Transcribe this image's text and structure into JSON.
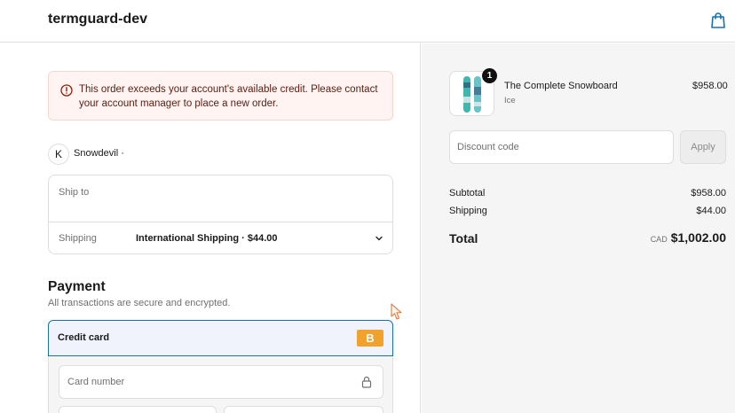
{
  "header": {
    "store_name": "termguard-dev",
    "cart_icon": "shopping-bag-icon"
  },
  "alert": {
    "icon": "warning-circle-icon",
    "message": "This order exceeds your account's available credit. Please contact your account manager to place a new order."
  },
  "account": {
    "avatar_initial": "K",
    "name": "Snowdevil ·"
  },
  "shipping": {
    "ship_to_label": "Ship to",
    "method_label": "Shipping",
    "method_value": "International Shipping · $44.00"
  },
  "payment": {
    "title": "Payment",
    "subtitle": "All transactions are secure and encrypted.",
    "method_label": "Credit card",
    "badge_text": "B",
    "card_number_placeholder": "Card number"
  },
  "summary": {
    "product": {
      "name": "The Complete Snowboard",
      "variant": "Ice",
      "price": "$958.00",
      "quantity": "1"
    },
    "discount_placeholder": "Discount code",
    "apply_label": "Apply",
    "subtotal_label": "Subtotal",
    "subtotal_value": "$958.00",
    "shipping_label": "Shipping",
    "shipping_value": "$44.00",
    "total_label": "Total",
    "currency": "CAD",
    "total_value": "$1,002.00"
  },
  "colors": {
    "accent": "#1773b0",
    "alert_bg": "#fff4f1",
    "badge": "#f0a22d",
    "summary_bg": "#f5f5f5"
  }
}
